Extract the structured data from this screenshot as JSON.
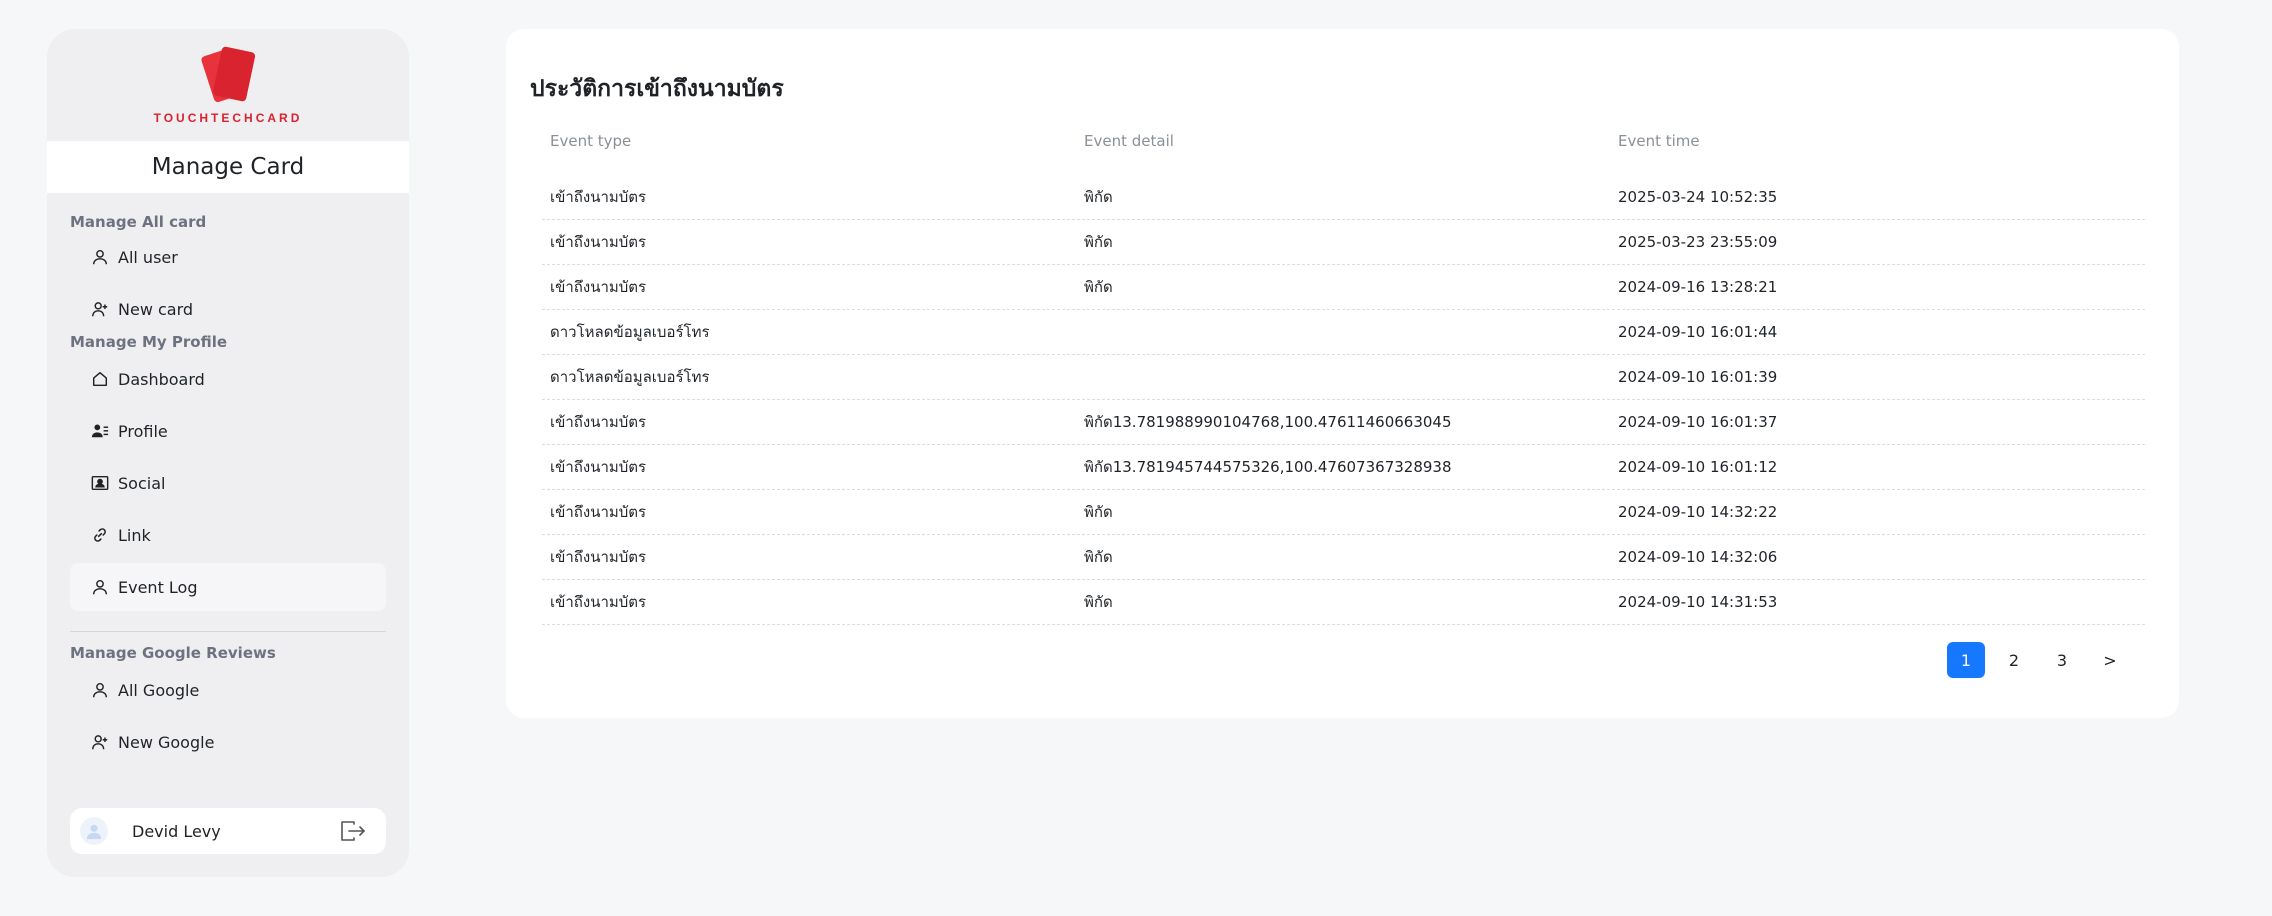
{
  "brand": {
    "logo_text": "TOUCHTECHCARD",
    "accent_color": "#d9232e",
    "title": "Manage Card"
  },
  "sidebar": {
    "sections": [
      {
        "label": "Manage All card",
        "items": [
          {
            "label": "All user",
            "icon": "user-icon"
          },
          {
            "label": "New card",
            "icon": "user-plus-icon"
          }
        ]
      },
      {
        "label": "Manage My Profile",
        "items": [
          {
            "label": "Dashboard",
            "icon": "home-icon"
          },
          {
            "label": "Profile",
            "icon": "profile-list-icon"
          },
          {
            "label": "Social",
            "icon": "contact-card-icon"
          },
          {
            "label": "Link",
            "icon": "link-icon"
          },
          {
            "label": "Event Log",
            "icon": "user-icon",
            "active": true
          }
        ]
      },
      {
        "label": "Manage Google Reviews",
        "items": [
          {
            "label": "All Google",
            "icon": "user-icon"
          },
          {
            "label": "New Google",
            "icon": "user-plus-icon"
          }
        ]
      }
    ],
    "user": {
      "name": "Devid Levy"
    }
  },
  "main": {
    "title": "ประวัติการเข้าถึงนามบัตร",
    "columns": [
      "Event type",
      "Event detail",
      "Event time"
    ],
    "rows": [
      [
        "เข้าถึงนามบัตร",
        "พิกัด",
        "2025-03-24 10:52:35"
      ],
      [
        "เข้าถึงนามบัตร",
        "พิกัด",
        "2025-03-23 23:55:09"
      ],
      [
        "เข้าถึงนามบัตร",
        "พิกัด",
        "2024-09-16 13:28:21"
      ],
      [
        "ดาวโหลดข้อมูลเบอร์โทร",
        "",
        "2024-09-10 16:01:44"
      ],
      [
        "ดาวโหลดข้อมูลเบอร์โทร",
        "",
        "2024-09-10 16:01:39"
      ],
      [
        "เข้าถึงนามบัตร",
        "พิกัด13.781988990104768,100.47611460663045",
        "2024-09-10 16:01:37"
      ],
      [
        "เข้าถึงนามบัตร",
        "พิกัด13.781945744575326,100.47607367328938",
        "2024-09-10 16:01:12"
      ],
      [
        "เข้าถึงนามบัตร",
        "พิกัด",
        "2024-09-10 14:32:22"
      ],
      [
        "เข้าถึงนามบัตร",
        "พิกัด",
        "2024-09-10 14:32:06"
      ],
      [
        "เข้าถึงนามบัตร",
        "พิกัด",
        "2024-09-10 14:31:53"
      ]
    ],
    "pagination": {
      "pages": [
        "1",
        "2",
        "3"
      ],
      "current": "1",
      "next": ">"
    }
  },
  "colors": {
    "pagination_active": "#1677ff",
    "background": "#f6f7f9"
  }
}
